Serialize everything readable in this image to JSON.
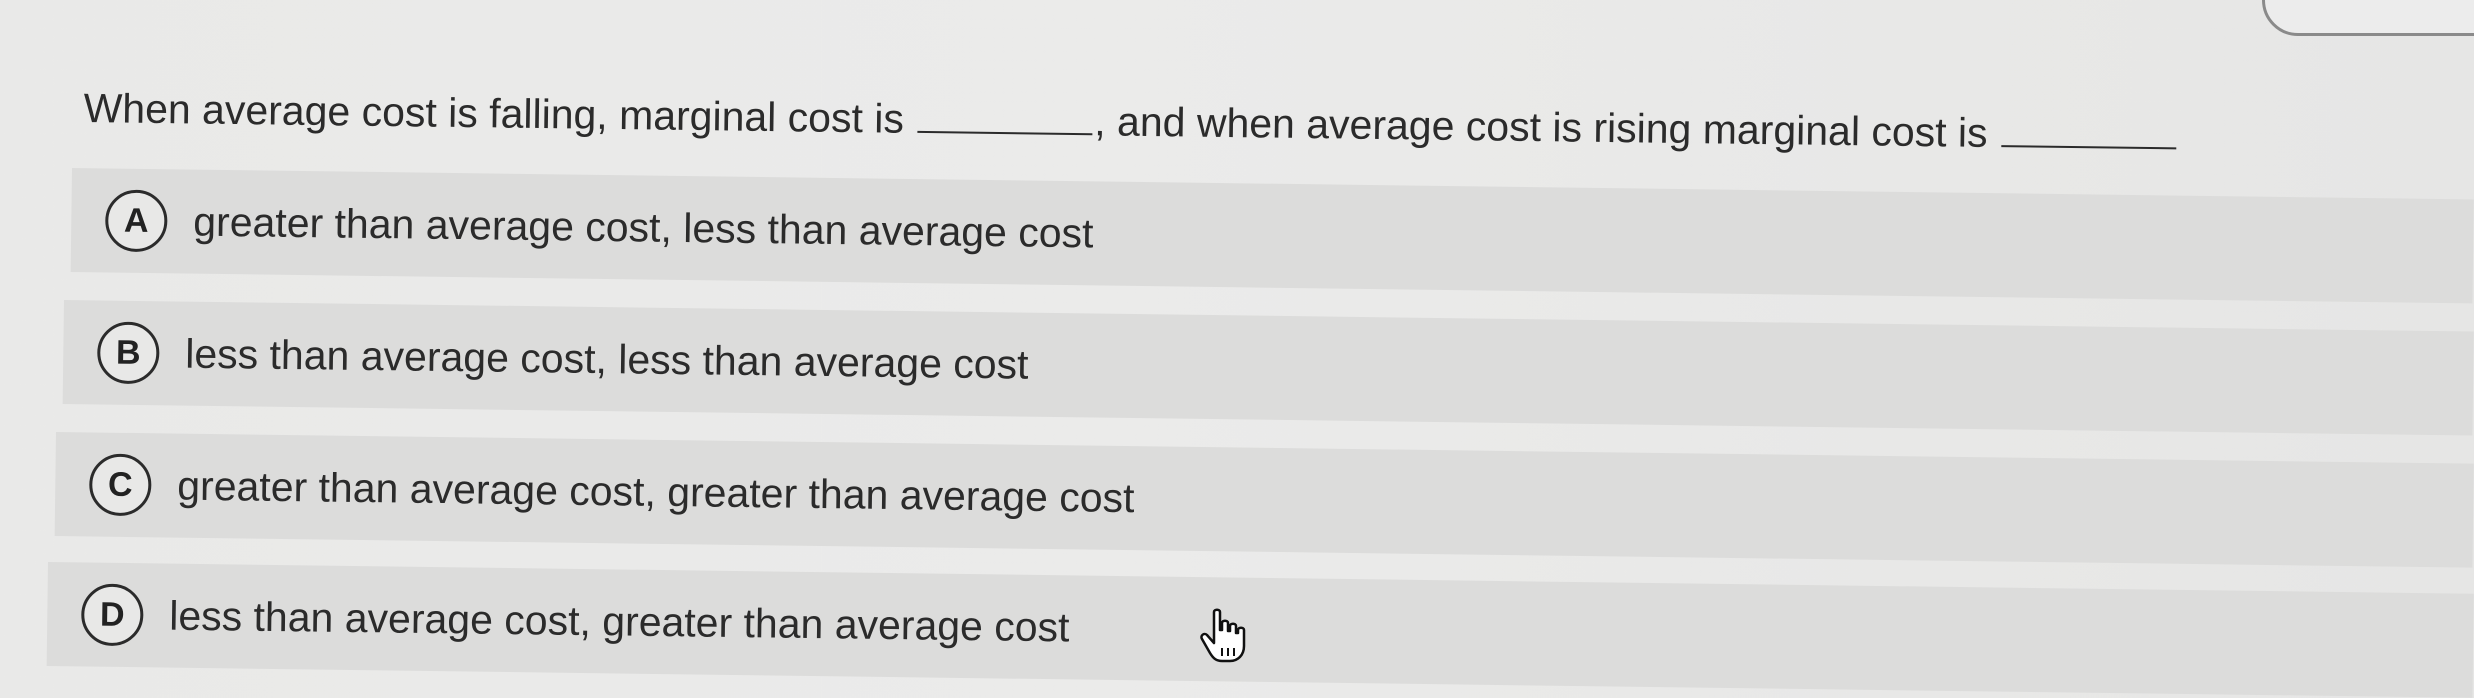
{
  "question": {
    "part1": "When average cost is falling, marginal cost is",
    "part2": ", and when average cost is rising marginal cost is"
  },
  "options": [
    {
      "letter": "A",
      "label": "greater than average cost, less than average cost"
    },
    {
      "letter": "B",
      "label": "less than average cost, less than average cost"
    },
    {
      "letter": "C",
      "label": "greater than average cost, greater than average cost"
    },
    {
      "letter": "D",
      "label": "less than average cost, greater than average cost"
    }
  ],
  "icons": {
    "cursor": "hand-pointer-icon"
  }
}
